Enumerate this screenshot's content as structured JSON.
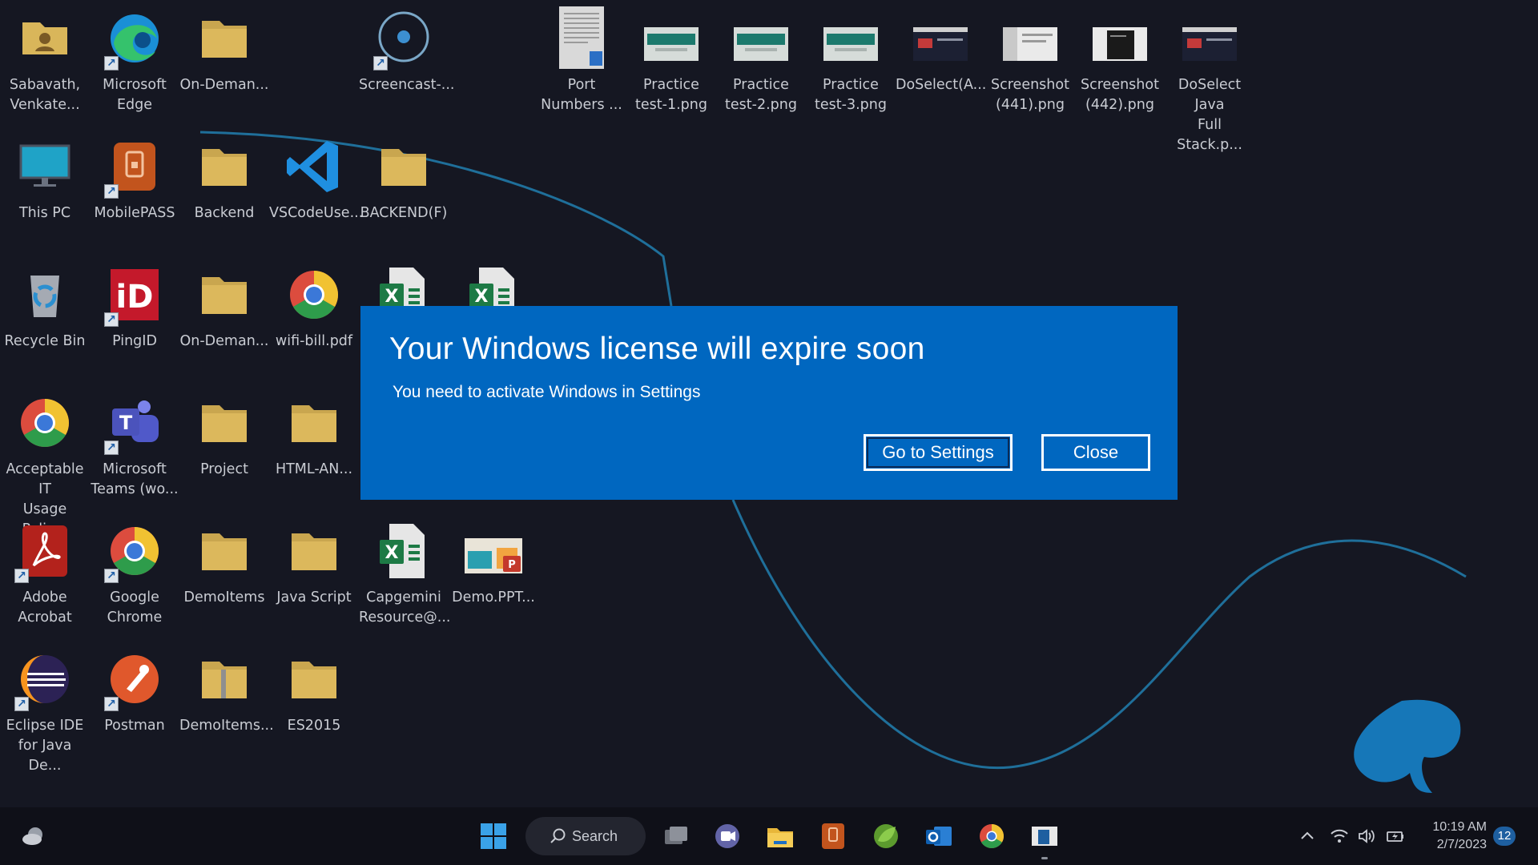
{
  "desktop": {
    "icons": [
      {
        "id": "sabavath",
        "label": "Sabavath,\nVenkate...",
        "icon": "user-folder-icon"
      },
      {
        "id": "edge",
        "label": "Microsoft\nEdge",
        "icon": "edge-icon"
      },
      {
        "id": "on-demand-1",
        "label": "On-Deman...",
        "icon": "folder-icon"
      },
      {
        "id": "screencast",
        "label": "Screencast-...",
        "icon": "screencast-icon"
      },
      {
        "id": "port-numbers",
        "label": "Port\nNumbers ...",
        "icon": "document-icon"
      },
      {
        "id": "practice-1",
        "label": "Practice\ntest-1.png",
        "icon": "image-thumb-icon"
      },
      {
        "id": "practice-2",
        "label": "Practice\ntest-2.png",
        "icon": "image-thumb-icon"
      },
      {
        "id": "practice-3",
        "label": "Practice\ntest-3.png",
        "icon": "image-thumb-icon"
      },
      {
        "id": "doselect-a",
        "label": "DoSelect(A...",
        "icon": "image-thumb-icon"
      },
      {
        "id": "screenshot-441",
        "label": "Screenshot\n(441).png",
        "icon": "image-thumb-icon"
      },
      {
        "id": "screenshot-442",
        "label": "Screenshot\n(442).png",
        "icon": "image-thumb-icon"
      },
      {
        "id": "doselect-java",
        "label": "DoSelect Java\nFull Stack.p...",
        "icon": "image-thumb-icon"
      },
      {
        "id": "this-pc",
        "label": "This PC",
        "icon": "monitor-icon"
      },
      {
        "id": "mobilepass",
        "label": "MobilePASS",
        "icon": "mobilepass-icon"
      },
      {
        "id": "backend",
        "label": "Backend",
        "icon": "folder-icon"
      },
      {
        "id": "vscode",
        "label": "VSCodeUse...",
        "icon": "vscode-icon"
      },
      {
        "id": "backend-f",
        "label": "BACKEND(F)",
        "icon": "folder-icon"
      },
      {
        "id": "recycle-bin",
        "label": "Recycle Bin",
        "icon": "recycle-bin-icon"
      },
      {
        "id": "pingid",
        "label": "PingID",
        "icon": "pingid-icon"
      },
      {
        "id": "on-demand-2",
        "label": "On-Deman...",
        "icon": "folder-icon"
      },
      {
        "id": "wifi-bill",
        "label": "wifi-bill.pdf",
        "icon": "chrome-icon"
      },
      {
        "id": "excel-1",
        "label": "",
        "icon": "excel-icon"
      },
      {
        "id": "excel-2",
        "label": "",
        "icon": "excel-icon"
      },
      {
        "id": "acceptable-it",
        "label": "Acceptable IT\nUsage Polic...",
        "icon": "chrome-icon"
      },
      {
        "id": "teams",
        "label": "Microsoft\nTeams (wo...",
        "icon": "teams-icon"
      },
      {
        "id": "project",
        "label": "Project",
        "icon": "folder-icon"
      },
      {
        "id": "html-an",
        "label": "HTML-AN...",
        "icon": "folder-icon"
      },
      {
        "id": "adobe",
        "label": "Adobe\nAcrobat",
        "icon": "acrobat-icon"
      },
      {
        "id": "google-chrome",
        "label": "Google\nChrome",
        "icon": "chrome-icon"
      },
      {
        "id": "demoitems",
        "label": "DemoItems",
        "icon": "folder-icon"
      },
      {
        "id": "javascript",
        "label": "Java Script",
        "icon": "folder-icon"
      },
      {
        "id": "capgemini",
        "label": "Capgemini\nResource@...",
        "icon": "excel-icon"
      },
      {
        "id": "demo-ppt",
        "label": "Demo.PPT...",
        "icon": "ppt-thumb-icon"
      },
      {
        "id": "eclipse",
        "label": "Eclipse IDE\nfor Java De...",
        "icon": "eclipse-icon"
      },
      {
        "id": "postman",
        "label": "Postman",
        "icon": "postman-icon"
      },
      {
        "id": "demoitems-zip",
        "label": "DemoItems...",
        "icon": "zip-folder-icon"
      },
      {
        "id": "es2015",
        "label": "ES2015",
        "icon": "folder-icon"
      }
    ]
  },
  "dialog": {
    "title": "Your Windows license will expire soon",
    "message": "You need to activate Windows in Settings",
    "primary_button": "Go to Settings",
    "secondary_button": "Close",
    "background_color": "#0067c0"
  },
  "taskbar": {
    "search_label": "Search",
    "apps": [
      "weather-icon",
      "start-icon",
      "task-view-icon",
      "teams-chat-icon",
      "file-explorer-icon",
      "mobilepass-icon",
      "spring-tools-icon",
      "outlook-icon",
      "chrome-icon",
      "active-window-icon"
    ],
    "clock_time": "10:19 AM",
    "clock_date": "2/7/2023",
    "notification_count": "12"
  }
}
